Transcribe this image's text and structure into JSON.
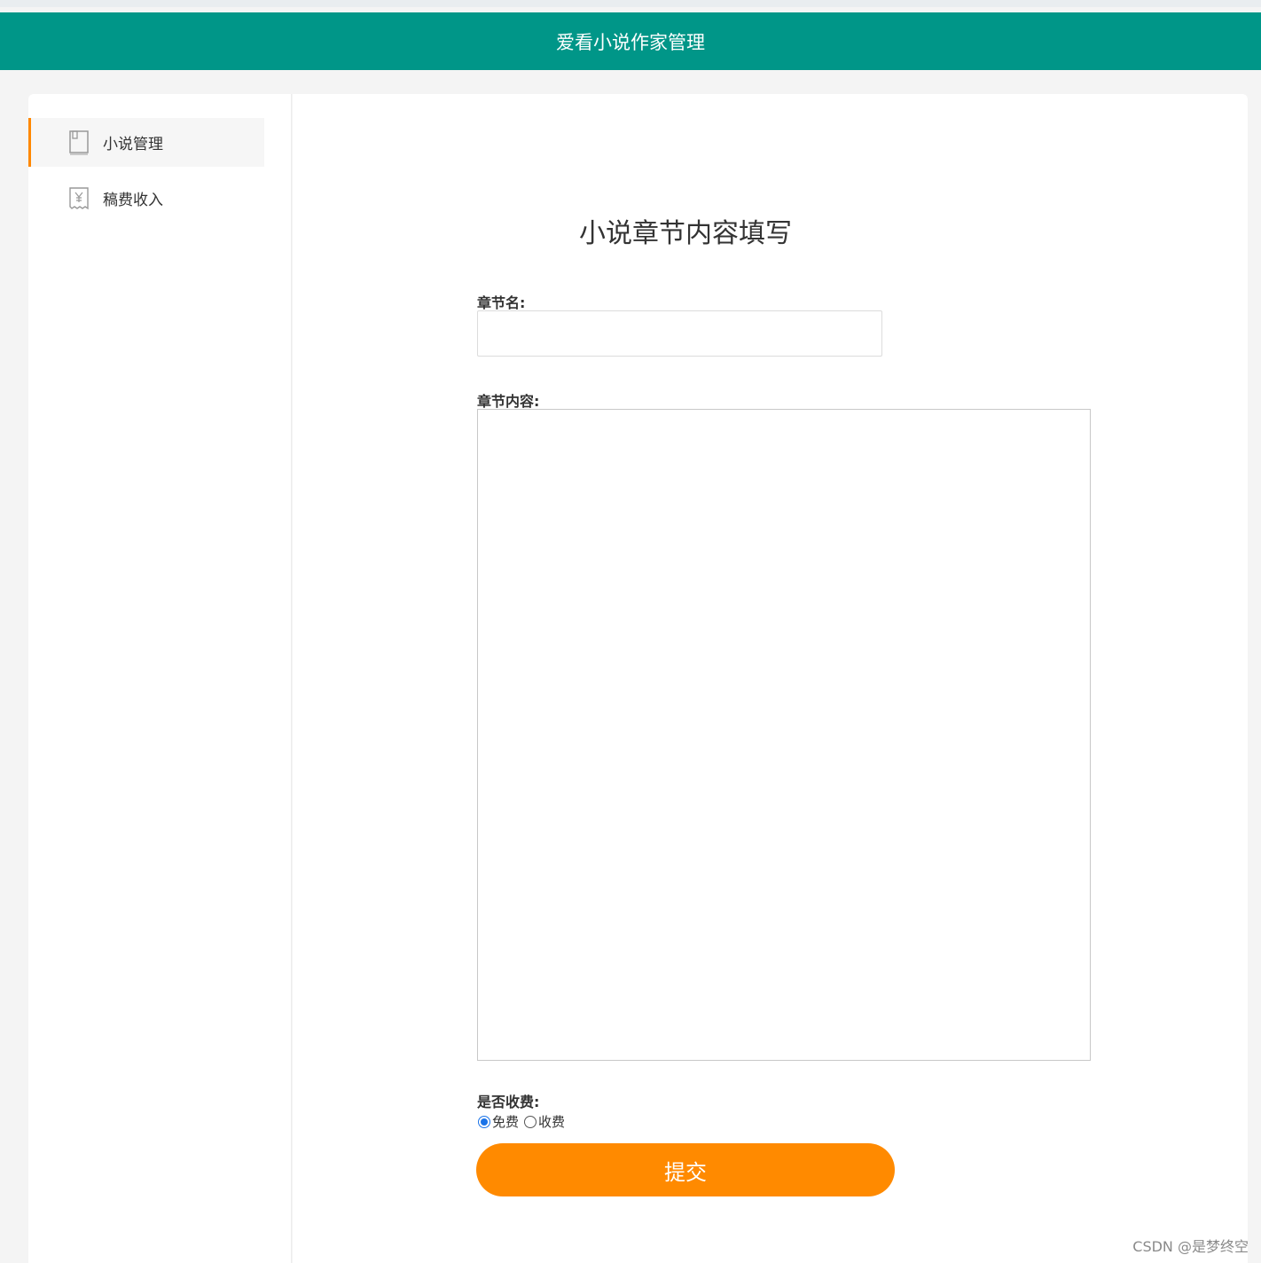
{
  "header": {
    "title": "爱看小说作家管理"
  },
  "sidebar": {
    "items": [
      {
        "label": "小说管理",
        "icon": "book-icon",
        "active": true
      },
      {
        "label": "稿费收入",
        "icon": "receipt-yen-icon",
        "active": false
      }
    ]
  },
  "form": {
    "title": "小说章节内容填写",
    "chapter_name_label": "章节名:",
    "chapter_name_value": "",
    "chapter_content_label": "章节内容:",
    "chapter_content_value": "",
    "charge_label": "是否收费:",
    "options": [
      {
        "label": "免费",
        "checked": true
      },
      {
        "label": "收费",
        "checked": false
      }
    ],
    "submit_label": "提交"
  },
  "watermark": "CSDN @是梦终空",
  "colors": {
    "header": "#009688",
    "accent": "#ff8a00",
    "active_border": "#ff8800"
  }
}
